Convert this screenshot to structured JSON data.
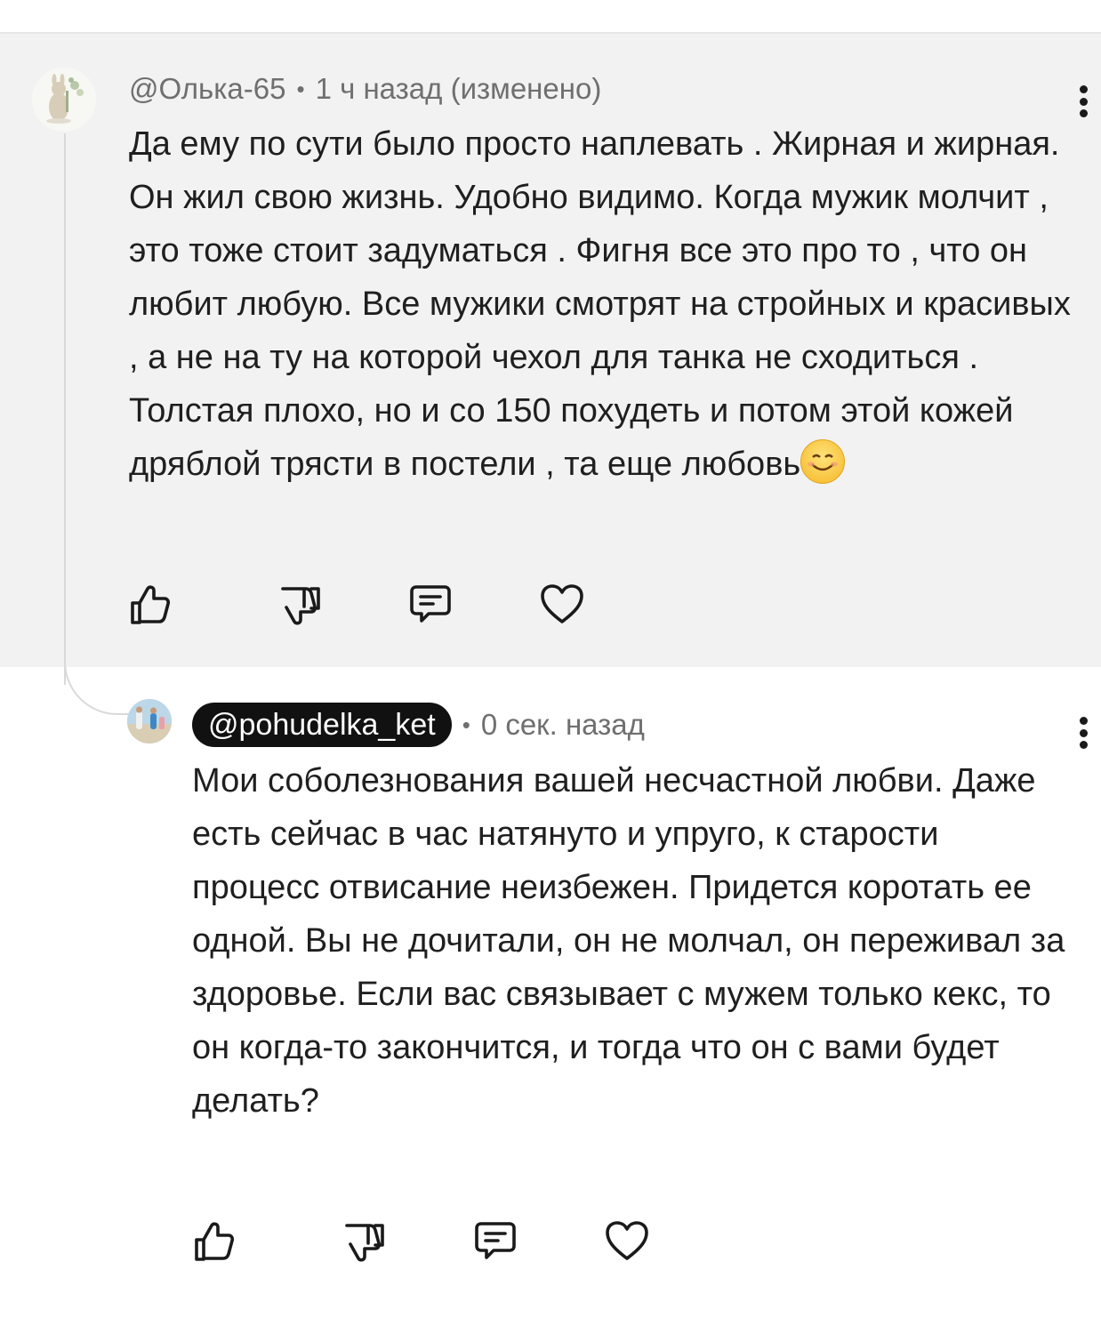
{
  "parent_comment": {
    "author": "@Олька-65",
    "separator": "•",
    "time": "1 ч назад (изменено)",
    "text": "Да ему по сути было просто наплевать . Жирная и жирная. Он жил свою жизнь. Удобно видимо. Когда мужик молчит , это тоже стоит задуматься . Фигня все это про то , что он любит любую. Все мужики смотрят на стройных и красивых , а не на ту на которой чехол для танка не сходиться . Толстая плохо, но и со 150 похудеть и потом этой кожей дряблой трясти в постели , та еще любовь",
    "emoji": "smiling-face-emoji",
    "actions": [
      "like-icon",
      "dislike-icon",
      "reply-icon",
      "heart-icon"
    ]
  },
  "reply_comment": {
    "author": "@pohudelka_ket",
    "separator": "•",
    "time": "0 сек. назад",
    "text": "Мои соболезнования вашей несчастной любви. Даже есть сейчас в час натянуто и упруго, к старости процесс отвисание неизбежен. Придется коротать ее одной. Вы не дочитали, он не молчал, он переживал за здоровье. Если вас связывает с мужем только кекс, то он когда-то закончится, и тогда что он с вами будет делать?",
    "actions": [
      "like-icon",
      "dislike-icon",
      "reply-icon",
      "heart-icon"
    ]
  },
  "colors": {
    "parent_background": "#f2f2f2",
    "author_pill": "#111111",
    "meta_text": "#6f6f6f",
    "body_text": "#1f1f1f"
  }
}
